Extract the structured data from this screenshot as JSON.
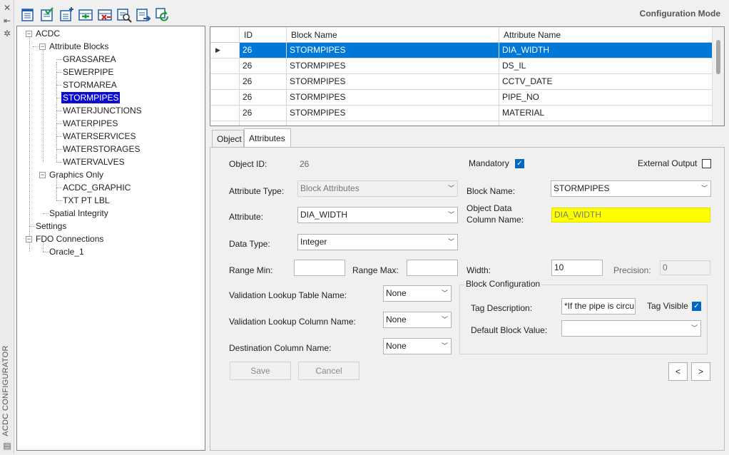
{
  "strip": {
    "icons": [
      "close-icon",
      "pin-icon",
      "settings-icon"
    ],
    "title": "ACDC CONFIGURATOR"
  },
  "toolbar": {
    "mode_label": "Configuration Mode",
    "buttons": [
      "list-view-icon",
      "validate-icon",
      "add-list-icon",
      "add-row-icon",
      "delete-row-icon",
      "search-table-icon",
      "export-icon",
      "refresh-icon"
    ]
  },
  "tree": {
    "root": "ACDC",
    "attribute_blocks": "Attribute Blocks",
    "blocks": [
      "GRASSAREA",
      "SEWERPIPE",
      "STORMAREA",
      "STORMPIPES",
      "WATERJUNCTIONS",
      "WATERPIPES",
      "WATERSERVICES",
      "WATERSTORAGES",
      "WATERVALVES"
    ],
    "selected_block": "STORMPIPES",
    "graphics_only": "Graphics Only",
    "graphics": [
      "ACDC_GRAPHIC",
      "TXT PT LBL"
    ],
    "spatial_integrity": "Spatial Integrity",
    "settings": "Settings",
    "fdo_connections": "FDO Connections",
    "fdo": [
      "Oracle_1"
    ]
  },
  "grid": {
    "headers": [
      "ID",
      "Block Name",
      "Attribute Name"
    ],
    "rows": [
      {
        "id": "26",
        "block": "STORMPIPES",
        "attr": "DIA_WIDTH"
      },
      {
        "id": "26",
        "block": "STORMPIPES",
        "attr": "DS_IL"
      },
      {
        "id": "26",
        "block": "STORMPIPES",
        "attr": "CCTV_DATE"
      },
      {
        "id": "26",
        "block": "STORMPIPES",
        "attr": "PIPE_NO"
      },
      {
        "id": "26",
        "block": "STORMPIPES",
        "attr": "MATERIAL"
      }
    ]
  },
  "tabs": [
    "Object",
    "Attributes"
  ],
  "form": {
    "object_id_label": "Object ID:",
    "object_id": "26",
    "mandatory_label": "Mandatory",
    "mandatory_checked": true,
    "external_output_label": "External Output",
    "external_output_checked": false,
    "attribute_type_label": "Attribute Type:",
    "attribute_type": "Block Attributes",
    "block_name_label": "Block Name:",
    "block_name": "STORMPIPES",
    "attribute_label": "Attribute:",
    "attribute": "DIA_WIDTH",
    "object_data_label_1": "Object Data",
    "object_data_label_2": "Column Name:",
    "object_data_column": "DIA_WIDTH",
    "data_type_label": "Data Type:",
    "data_type": "Integer",
    "range_min_label": "Range Min:",
    "range_min": "",
    "range_max_label": "Range Max:",
    "range_max": "",
    "width_label": "Width:",
    "width": "10",
    "precision_label": "Precision:",
    "precision": "0",
    "lookup_table_label": "Validation Lookup Table Name:",
    "lookup_table": "None",
    "lookup_column_label": "Validation Lookup Column Name:",
    "lookup_column": "None",
    "dest_column_label": "Destination Column Name:",
    "dest_column": "None",
    "block_config_title": "Block Configuration",
    "tag_description_label": "Tag Description:",
    "tag_description": "*If the pipe is circu",
    "tag_visible_label": "Tag Visible",
    "tag_visible_checked": true,
    "default_block_value_label": "Default Block Value:",
    "default_block_value": "",
    "save_label": "Save",
    "cancel_label": "Cancel",
    "prev_label": "<",
    "next_label": ">"
  },
  "colors": {
    "selection_blue": "#0078d7",
    "tree_selection": "#0a0ad0",
    "highlight_yellow": "#ffff00",
    "checkbox_blue": "#0067c0"
  }
}
